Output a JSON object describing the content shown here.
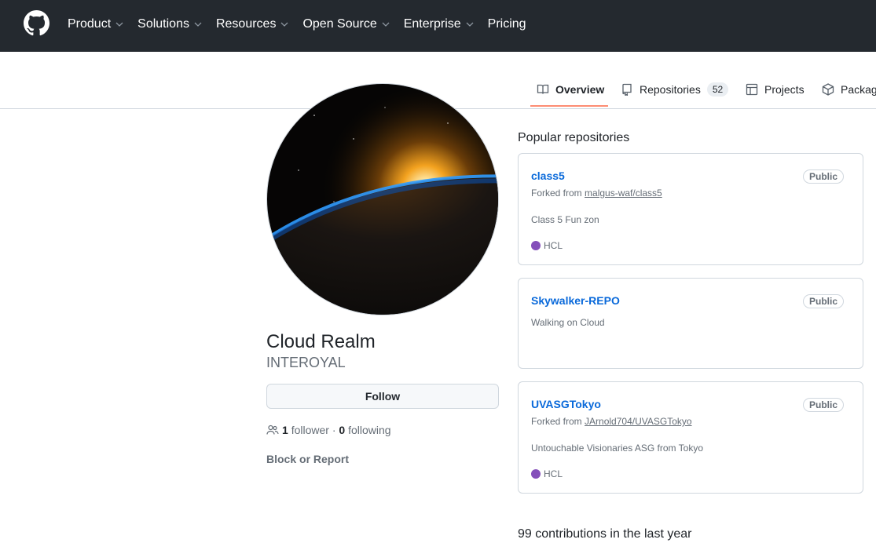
{
  "header": {
    "nav": [
      {
        "label": "Product",
        "has_menu": true
      },
      {
        "label": "Solutions",
        "has_menu": true
      },
      {
        "label": "Resources",
        "has_menu": true
      },
      {
        "label": "Open Source",
        "has_menu": true
      },
      {
        "label": "Enterprise",
        "has_menu": true
      },
      {
        "label": "Pricing",
        "has_menu": false
      }
    ]
  },
  "tabs": {
    "overview": "Overview",
    "repositories": "Repositories",
    "repositories_count": "52",
    "projects": "Projects",
    "packages": "Packages"
  },
  "profile": {
    "fullname": "Cloud Realm",
    "username": "INTEROYAL",
    "follow_label": "Follow",
    "followers_count": "1",
    "followers_label": "follower",
    "separator": "·",
    "following_count": "0",
    "following_label": "following",
    "block_label": "Block or Report"
  },
  "popular": {
    "title": "Popular repositories",
    "repos": [
      {
        "name": "class5",
        "badge": "Public",
        "forked_prefix": "Forked from",
        "forked_from": "malgus-waf/class5",
        "description": "Class 5 Fun zon",
        "language": "HCL"
      },
      {
        "name": "Skywalker-REPO",
        "badge": "Public",
        "description": "Walking on Cloud"
      },
      {
        "name": "UVASGTokyo",
        "badge": "Public",
        "forked_prefix": "Forked from",
        "forked_from": "JArnold704/UVASGTokyo",
        "description": "Untouchable Visionaries ASG from Tokyo",
        "language": "HCL"
      }
    ]
  },
  "contributions": {
    "text": "99 contributions in the last year"
  },
  "colors": {
    "header_bg": "#24292f",
    "link": "#0969da",
    "tab_active_underline": "#fd8c73",
    "hcl_lang": "#844fba"
  }
}
